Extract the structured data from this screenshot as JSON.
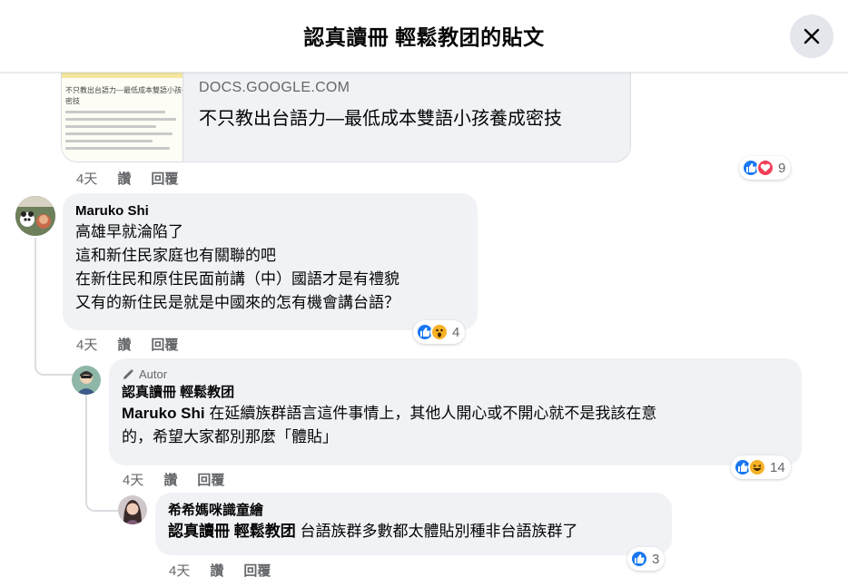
{
  "header": {
    "title": "認真讀冊 輕鬆教团的貼文"
  },
  "link_preview": {
    "domain": "DOCS.GOOGLE.COM",
    "title": "不只教出台語力—最低成本雙語小孩養成密技",
    "thumb_heading": "不只教出台語力—最低成本雙語小孩養成",
    "thumb_subheading": "密技"
  },
  "post_actions": {
    "time": "4天",
    "like": "讚",
    "reply": "回覆",
    "reaction_count": "9"
  },
  "comments": [
    {
      "author": "Maruko Shi",
      "lines": [
        "高雄早就淪陷了",
        "這和新住民家庭也有關聯的吧",
        "在新住民和原住民面前講（中）國語才是有禮貌",
        "又有的新住民是就是中國來的怎有機會講台語？"
      ],
      "time": "4天",
      "like": "讚",
      "reply": "回覆",
      "reaction_count": "4"
    },
    {
      "badge": "Autor",
      "author": "認真讀冊 輕鬆教团",
      "mention": "Maruko Shi",
      "line1": " 在延續族群語言這件事情上，其他人開心或不開心就不是我該在意",
      "line2": "的，希望大家都別那麼「體貼」",
      "time": "4天",
      "like": "讚",
      "reply": "回覆",
      "reaction_count": "14"
    },
    {
      "author": "希希媽咪識童繪",
      "mention": "認真讀冊 輕鬆教团",
      "text": " 台語族群多數都太體貼別種非台語族群了",
      "time": "4天",
      "like": "讚",
      "reply": "回覆",
      "reaction_count": "3"
    }
  ],
  "colors": {
    "like_blue": "#1877f2",
    "love_red": "#f33e58",
    "haha_yellow": "#f7b125",
    "bubble_bg": "#f0f2f5",
    "muted_text": "#65676b"
  },
  "icons": [
    "close-icon",
    "like-icon",
    "love-icon",
    "wow-icon",
    "haha-icon",
    "pencil-icon"
  ]
}
